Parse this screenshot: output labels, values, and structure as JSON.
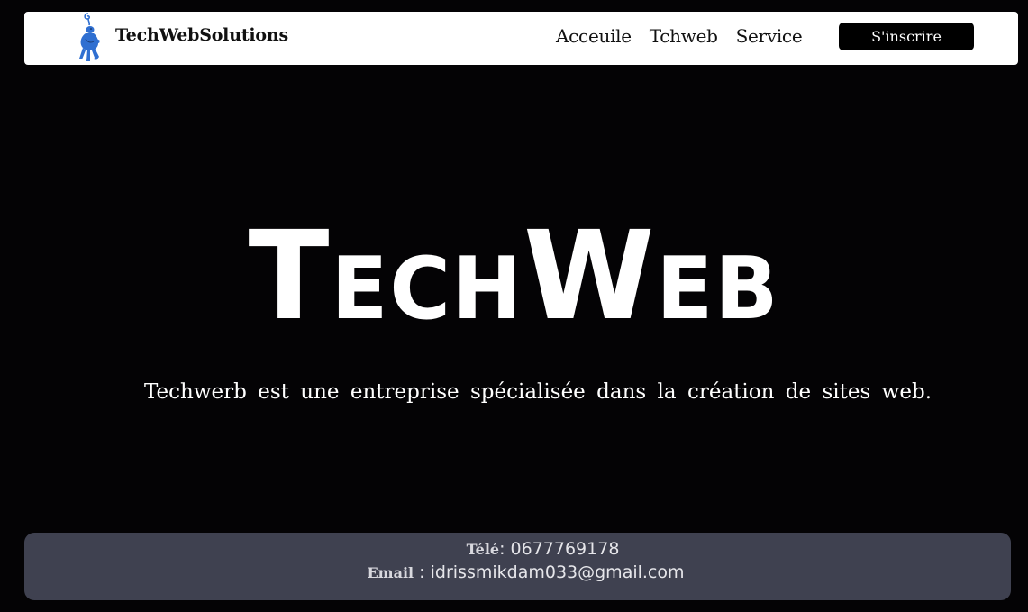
{
  "header": {
    "brand": "TechWebSolutions",
    "logo_icon": "blue-panther-logo-icon",
    "nav": [
      {
        "label": "Acceuile"
      },
      {
        "label": "Tchweb"
      },
      {
        "label": "Service"
      }
    ],
    "signup_label": "S'inscrire"
  },
  "hero": {
    "title": "TechWeb",
    "subtitle": "Techwerb est une entreprise spécialisée dans la création de sites web."
  },
  "footer": {
    "phone_label": "Télé",
    "phone_sep": ":",
    "phone_value": "0677769178",
    "email_label": "Email",
    "email_sep": ":",
    "email_value": "idrissmikdam033@gmail.com"
  },
  "colors": {
    "background": "#040305",
    "navbar_bg": "#ffffff",
    "logo_blue": "#2f6fd1",
    "button_bg": "#000000",
    "footer_bg": "#3f4150"
  }
}
